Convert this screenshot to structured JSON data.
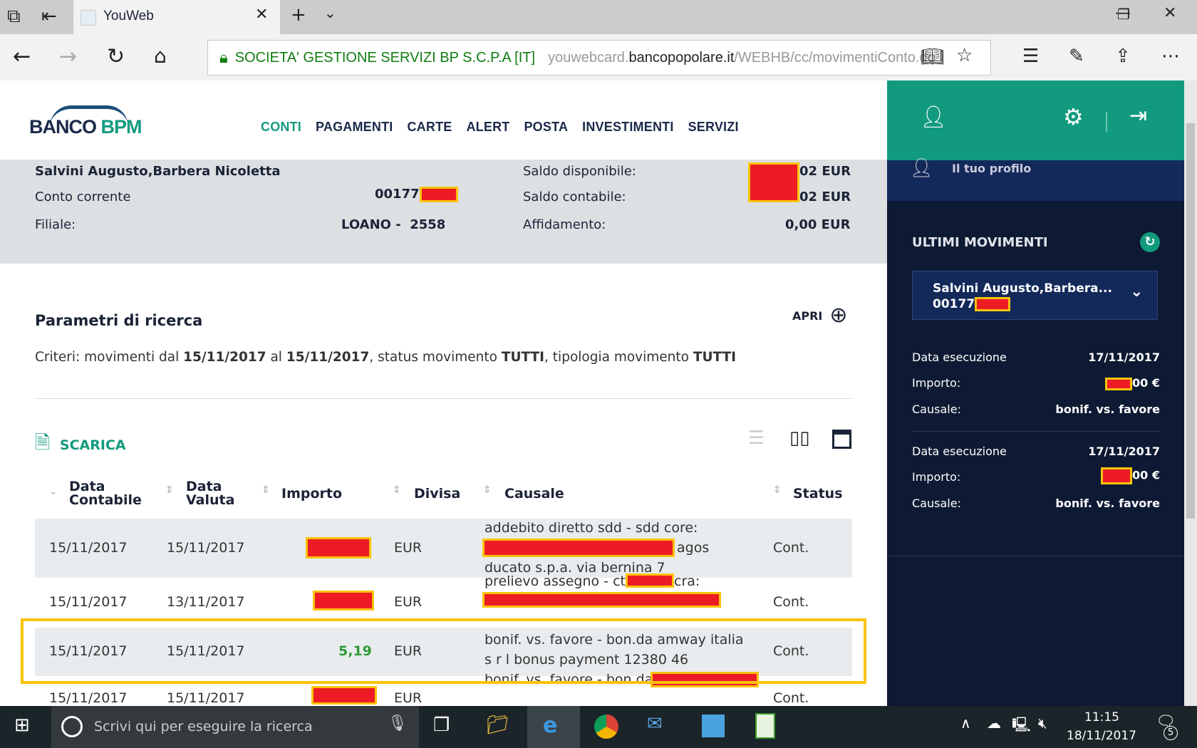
{
  "browser": {
    "tab_title": "YouWeb",
    "cert": "SOCIETA' GESTIONE SERVIZI BP S.C.P.A [IT]",
    "url_pre": "youwebcard.",
    "url_domain": "bancopopolare.it",
    "url_path": "/WEBHB/cc/movimentiConto.do"
  },
  "brand": {
    "logo": "BANCO BPM",
    "accent": "#129a7f",
    "navy": "#0e1a33"
  },
  "menu": [
    "CONTI",
    "PAGAMENTI",
    "CARTE",
    "ALERT",
    "POSTA",
    "INVESTIMENTI",
    "SERVIZI"
  ],
  "account": {
    "holder": "Salvini Augusto,Barbera Nicoletta",
    "conto_label": "Conto corrente",
    "conto_value": "00177",
    "filiale_label": "Filiale:",
    "filiale_value": "LOANO -  2558",
    "saldo_disp_label": "Saldo disponibile:",
    "saldo_disp_value": "02 EUR",
    "saldo_cont_label": "Saldo contabile:",
    "saldo_cont_value": "02 EUR",
    "affid_label": "Affidamento:",
    "affid_value": "0,00 EUR"
  },
  "search": {
    "title": "Parametri di ricerca",
    "open_label": "APRI",
    "c1": "Criteri: movimenti dal ",
    "d1": "15/11/2017",
    "c2": " al ",
    "d2": "15/11/2017",
    "c3": ", status movimento ",
    "s": "TUTTI",
    "c4": ", tipologia movimento ",
    "t": "TUTTI"
  },
  "download_label": "SCARICA",
  "table": {
    "headers": [
      "Data\nContabile",
      "Data\nValuta",
      "Importo",
      "Divisa",
      "Causale",
      "Status"
    ],
    "rows": [
      {
        "contabile": "15/11/2017",
        "valuta": "15/11/2017",
        "importo": "",
        "divisa": "EUR",
        "causale_a": "addebito diretto sdd - sdd core:",
        "causale_b": "agos",
        "causale_c": "ducato s.p.a. via bernina 7",
        "status": "Cont."
      },
      {
        "contabile": "15/11/2017",
        "valuta": "13/11/2017",
        "importo": "",
        "divisa": "EUR",
        "causale_a": "prelievo assegno - ct",
        "causale_b": "cra:",
        "status": "Cont."
      },
      {
        "contabile": "15/11/2017",
        "valuta": "15/11/2017",
        "importo": "5,19",
        "divisa": "EUR",
        "causale_a": "bonif. vs. favore - bon.da amway italia",
        "causale_b": "s r l bonus payment 12380 46",
        "status": "Cont."
      },
      {
        "contabile": "15/11/2017",
        "valuta": "15/11/2017",
        "importo": "",
        "divisa": "EUR",
        "causale_a": "bonif. vs. favore - bon.da",
        "status": "Cont."
      }
    ]
  },
  "sidebar": {
    "profile": "Il tuo profilo",
    "ultimi": "ULTIMI MOVIMENTI",
    "account_name": "Salvini Augusto,Barbera...",
    "account_no": "00177",
    "movements": [
      {
        "l1": "Data esecuzione",
        "v1": "17/11/2017",
        "l2": "Importo:",
        "v2": "00 €",
        "l3": "Causale:",
        "v3": "bonif. vs. favore"
      },
      {
        "l1": "Data esecuzione",
        "v1": "17/11/2017",
        "l2": "Importo:",
        "v2": "00 €",
        "l3": "Causale:",
        "v3": "bonif. vs. favore"
      }
    ]
  },
  "taskbar": {
    "search_placeholder": "Scrivi qui per eseguire la ricerca",
    "time": "11:15",
    "date": "18/11/2017",
    "notifications": "5"
  }
}
